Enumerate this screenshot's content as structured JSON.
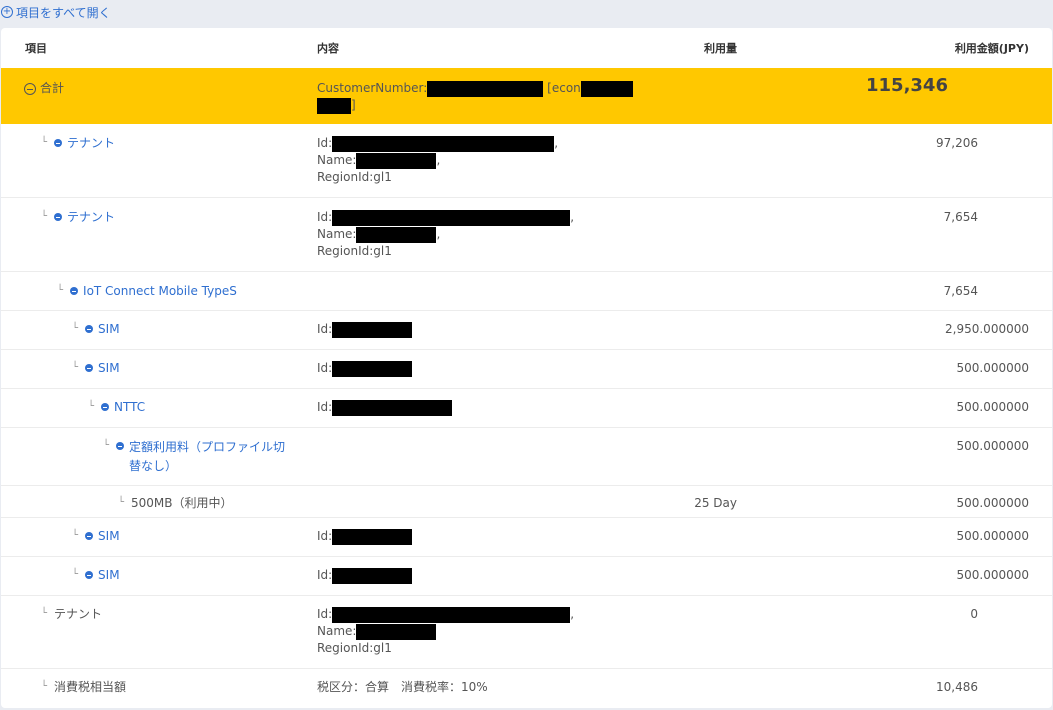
{
  "toolbar": {
    "expand_all": "項目をすべて開く"
  },
  "columns": {
    "item": "項目",
    "content": "内容",
    "usage": "利用量",
    "amount": "利用金額(JPY)"
  },
  "total": {
    "label": "合計",
    "customer_prefix": "CustomerNumber:",
    "econ_prefix": "[econ",
    "close_bracket": "]",
    "amount": "115,346"
  },
  "rows": [
    {
      "label": "テナント",
      "id_prefix": "Id:",
      "id_suffix": ",",
      "name_prefix": "Name:",
      "name_suffix": ",",
      "region": "RegionId:gl1",
      "amount": "97,206"
    },
    {
      "label": "テナント",
      "id_prefix": "Id:",
      "id_suffix": ",",
      "name_prefix": "Name:",
      "name_suffix": ",",
      "region": "RegionId:gl1",
      "amount": "7,654"
    },
    {
      "label": "IoT Connect Mobile TypeS",
      "amount": "7,654"
    },
    {
      "label": "SIM",
      "id_prefix": "Id:",
      "amount": "2,950.000000"
    },
    {
      "label": "SIM",
      "id_prefix": "Id:",
      "amount": "500.000000"
    },
    {
      "label": "NTTC",
      "id_prefix": "Id:",
      "amount": "500.000000"
    },
    {
      "label_line1": "定額利用料（プロファイル切",
      "label_line2": "替なし）",
      "amount": "500.000000"
    },
    {
      "label": "500MB（利用中）",
      "usage": "25 Day",
      "amount": "500.000000"
    },
    {
      "label": "SIM",
      "id_prefix": "Id:",
      "amount": "500.000000"
    },
    {
      "label": "SIM",
      "id_prefix": "Id:",
      "amount": "500.000000"
    },
    {
      "label": "テナント",
      "id_prefix": "Id:",
      "id_suffix": ",",
      "name_prefix": "Name:",
      "region": "RegionId:gl1",
      "amount": "0"
    },
    {
      "label": "消費税相当額",
      "content": "税区分：合算　消費税率：10%",
      "amount": "10,486"
    }
  ],
  "elbow_glyph": "└",
  "colors": {
    "accent": "#2f6fd0",
    "total_bg": "#ffc800",
    "redaction": "#000000"
  }
}
